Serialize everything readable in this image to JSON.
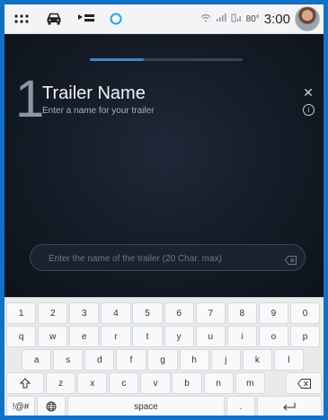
{
  "status_bar": {
    "icons": [
      "apps-grid-icon",
      "car-icon",
      "media-icon",
      "voice-assistant-icon"
    ],
    "temperature": "80°",
    "time": "3:00"
  },
  "wizard": {
    "step_number": "1",
    "title": "Trailer Name",
    "subtitle": "Enter a name for your trailer",
    "progress": 0.35,
    "input_placeholder": "Enter the name of the trailer (20 Char. max)",
    "input_value": ""
  },
  "keyboard": {
    "row1": [
      "1",
      "2",
      "3",
      "4",
      "5",
      "6",
      "7",
      "8",
      "9",
      "0"
    ],
    "row2": [
      "q",
      "w",
      "e",
      "r",
      "t",
      "y",
      "u",
      "i",
      "o",
      "p"
    ],
    "row3": [
      "a",
      "s",
      "d",
      "f",
      "g",
      "h",
      "j",
      "k",
      "l"
    ],
    "row4": [
      "z",
      "x",
      "c",
      "v",
      "b",
      "n",
      "m"
    ],
    "symbols_label": "!@#",
    "space_label": "space",
    "period_label": "."
  },
  "colors": {
    "frame": "#0f72c8",
    "accent": "#3e86d0",
    "background": "#141b26",
    "keyboard": "#e8eaec"
  }
}
